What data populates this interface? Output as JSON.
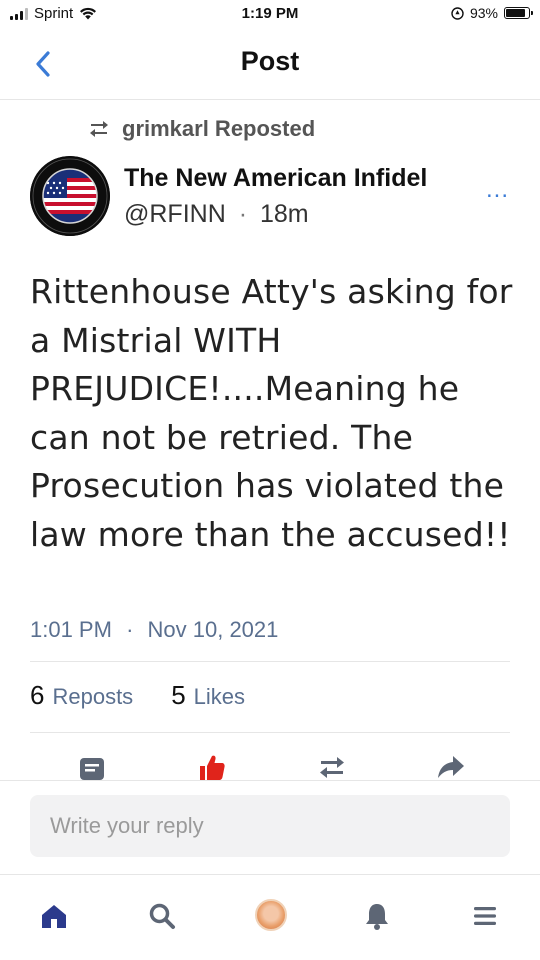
{
  "status_bar": {
    "carrier": "Sprint",
    "time": "1:19 PM",
    "battery_percent": "93%",
    "battery_level": 0.93
  },
  "nav": {
    "title": "Post"
  },
  "repost": {
    "text": "grimkarl Reposted"
  },
  "author": {
    "name": "The New American Infidel",
    "handle": "@RFINN",
    "age": "18m",
    "separator": "·",
    "more": "..."
  },
  "post": {
    "text": "Rittenhouse Atty's asking for a Mistrial WITH PREJUDICE!....Meaning he can not be retried. The Prosecution has violated the law more than the accused!!",
    "time": "1:01 PM",
    "date": "Nov 10, 2021",
    "separator": "·"
  },
  "stats": {
    "reposts_count": "6",
    "reposts_label": "Reposts",
    "likes_count": "5",
    "likes_label": "Likes"
  },
  "reply": {
    "placeholder": "Write your reply"
  },
  "colors": {
    "accent": "#3b7bd6",
    "like_active": "#e0241b",
    "nav_home": "#2b3a8c",
    "muted_text": "#5a6f8f"
  },
  "icons": {
    "back": "chevron-left-icon",
    "repost": "repost-icon",
    "comment": "comment-icon",
    "like": "thumbs-up-icon",
    "share": "share-arrow-icon",
    "home": "home-icon",
    "search": "search-icon",
    "notifications": "bell-icon",
    "menu": "menu-icon"
  }
}
